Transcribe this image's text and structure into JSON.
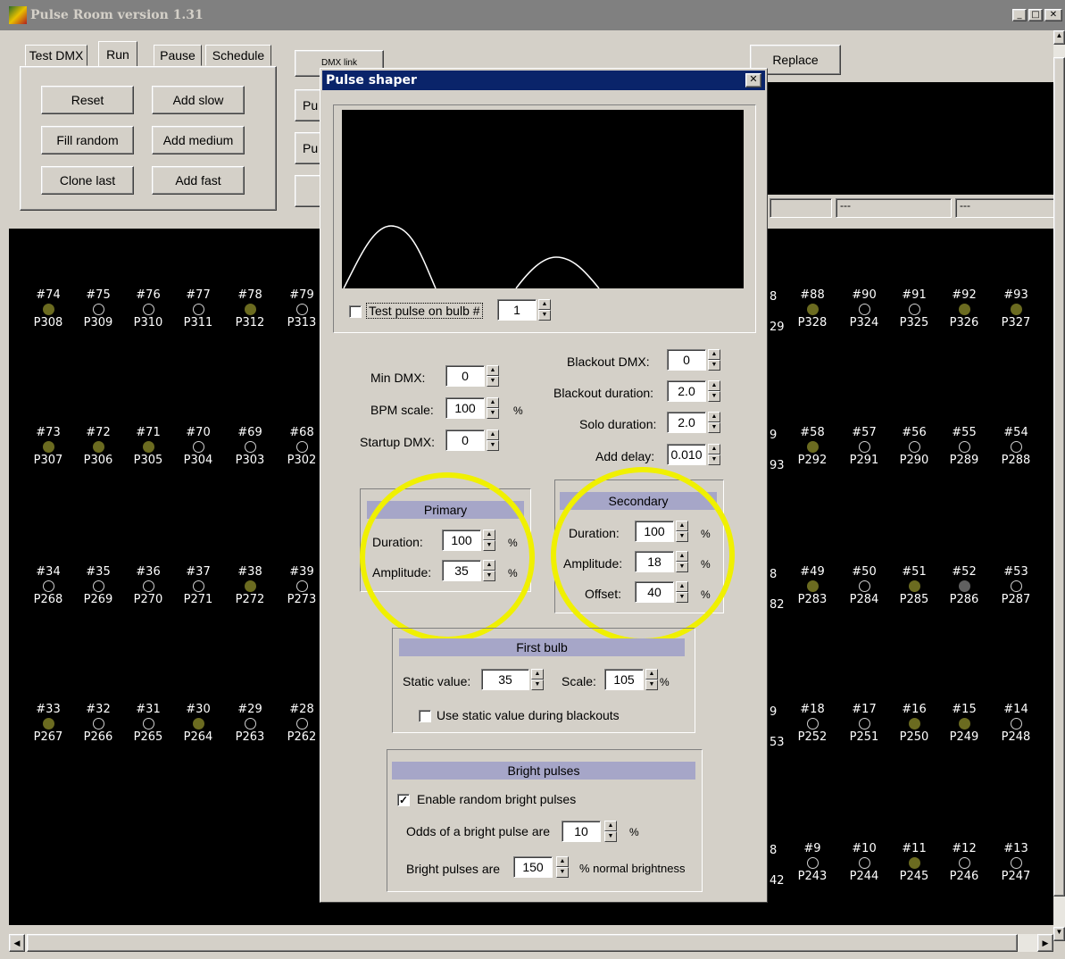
{
  "app": {
    "title": "Pulse Room version 1.31"
  },
  "tabs": [
    {
      "label": "Test DMX"
    },
    {
      "label": "Run"
    },
    {
      "label": "Pause"
    },
    {
      "label": "Schedule"
    }
  ],
  "run_buttons": {
    "reset": "Reset",
    "add_slow": "Add slow",
    "fill_random": "Fill random",
    "add_medium": "Add medium",
    "clone_last": "Clone last",
    "add_fast": "Add fast"
  },
  "hidden_buttons": {
    "dmx_link": "DMX link",
    "pu1": "Pu",
    "pu2": "Pu"
  },
  "replace_button": "Replace",
  "status_fields": [
    "---",
    "---"
  ],
  "bulbs_row1": [
    {
      "n": "#74",
      "p": "P308",
      "state": "on"
    },
    {
      "n": "#75",
      "p": "P309",
      "state": "off"
    },
    {
      "n": "#76",
      "p": "P310",
      "state": "off"
    },
    {
      "n": "#77",
      "p": "P311",
      "state": "off"
    },
    {
      "n": "#78",
      "p": "P312",
      "state": "on"
    },
    {
      "n": "#79",
      "p": "P313",
      "state": "off"
    },
    {
      "n": "#88",
      "p": "P328",
      "state": "on"
    },
    {
      "n": "#90",
      "p": "P324",
      "state": "off"
    },
    {
      "n": "#91",
      "p": "P325",
      "state": "off"
    },
    {
      "n": "#92",
      "p": "P326",
      "state": "on"
    },
    {
      "n": "#93",
      "p": "P327",
      "state": "on"
    }
  ],
  "bulbs_row2": [
    {
      "n": "#73",
      "p": "P307",
      "state": "on"
    },
    {
      "n": "#72",
      "p": "P306",
      "state": "on"
    },
    {
      "n": "#71",
      "p": "P305",
      "state": "on"
    },
    {
      "n": "#70",
      "p": "P304",
      "state": "off"
    },
    {
      "n": "#69",
      "p": "P303",
      "state": "off"
    },
    {
      "n": "#68",
      "p": "P302",
      "state": "off"
    },
    {
      "n": "#58",
      "p": "P292",
      "state": "on"
    },
    {
      "n": "#57",
      "p": "P291",
      "state": "off"
    },
    {
      "n": "#56",
      "p": "P290",
      "state": "off"
    },
    {
      "n": "#55",
      "p": "P289",
      "state": "off"
    },
    {
      "n": "#54",
      "p": "P288",
      "state": "off"
    }
  ],
  "bulbs_row3": [
    {
      "n": "#34",
      "p": "P268",
      "state": "off"
    },
    {
      "n": "#35",
      "p": "P269",
      "state": "off"
    },
    {
      "n": "#36",
      "p": "P270",
      "state": "off"
    },
    {
      "n": "#37",
      "p": "P271",
      "state": "off"
    },
    {
      "n": "#38",
      "p": "P272",
      "state": "on"
    },
    {
      "n": "#39",
      "p": "P273",
      "state": "off"
    },
    {
      "n": "#49",
      "p": "P283",
      "state": "on"
    },
    {
      "n": "#50",
      "p": "P284",
      "state": "off"
    },
    {
      "n": "#51",
      "p": "P285",
      "state": "on"
    },
    {
      "n": "#52",
      "p": "P286",
      "state": "gray"
    },
    {
      "n": "#53",
      "p": "P287",
      "state": "off"
    }
  ],
  "bulbs_row4": [
    {
      "n": "#33",
      "p": "P267",
      "state": "on"
    },
    {
      "n": "#32",
      "p": "P266",
      "state": "off"
    },
    {
      "n": "#31",
      "p": "P265",
      "state": "off"
    },
    {
      "n": "#30",
      "p": "P264",
      "state": "on"
    },
    {
      "n": "#29",
      "p": "P263",
      "state": "off"
    },
    {
      "n": "#28",
      "p": "P262",
      "state": "off"
    },
    {
      "n": "#18",
      "p": "P252",
      "state": "off"
    },
    {
      "n": "#17",
      "p": "P251",
      "state": "off"
    },
    {
      "n": "#16",
      "p": "P250",
      "state": "on"
    },
    {
      "n": "#15",
      "p": "P249",
      "state": "on"
    },
    {
      "n": "#14",
      "p": "P248",
      "state": "off"
    }
  ],
  "bulbs_row5": [
    {
      "n": "#9",
      "p": "P243",
      "state": "off"
    },
    {
      "n": "#10",
      "p": "P244",
      "state": "off"
    },
    {
      "n": "#11",
      "p": "P245",
      "state": "on"
    },
    {
      "n": "#12",
      "p": "P246",
      "state": "off"
    },
    {
      "n": "#13",
      "p": "P247",
      "state": "off"
    }
  ],
  "partial_labels": {
    "r1a": "8",
    "r1b": "29",
    "r2a": "9",
    "r2b": "93",
    "r3a": "8",
    "r3b": "82",
    "r4a": "9",
    "r4b": "53",
    "r5a": "8",
    "r5b": "42"
  },
  "dialog": {
    "title": "Pulse shaper",
    "test_pulse_label": "Test pulse on bulb #",
    "test_pulse_value": "1",
    "min_dmx_label": "Min DMX:",
    "min_dmx": "0",
    "bpm_scale_label": "BPM scale:",
    "bpm_scale": "100",
    "bpm_unit": "%",
    "startup_dmx_label": "Startup DMX:",
    "startup_dmx": "0",
    "blackout_dmx_label": "Blackout DMX:",
    "blackout_dmx": "0",
    "blackout_duration_label": "Blackout duration:",
    "blackout_duration": "2.0",
    "solo_duration_label": "Solo duration:",
    "solo_duration": "2.0",
    "add_delay_label": "Add delay:",
    "add_delay": "0.010",
    "primary": {
      "title": "Primary",
      "duration_label": "Duration:",
      "duration": "100",
      "amplitude_label": "Amplitude:",
      "amplitude": "35",
      "unit": "%"
    },
    "secondary": {
      "title": "Secondary",
      "duration_label": "Duration:",
      "duration": "100",
      "amplitude_label": "Amplitude:",
      "amplitude": "18",
      "offset_label": "Offset:",
      "offset": "40",
      "unit": "%"
    },
    "first_bulb": {
      "title": "First bulb",
      "static_label": "Static value:",
      "static_value": "35",
      "scale_label": "Scale:",
      "scale": "105",
      "unit": "%",
      "use_static_label": "Use static value during blackouts"
    },
    "bright": {
      "title": "Bright pulses",
      "enable_label": "Enable random bright pulses",
      "odds_label": "Odds of a bright pulse are",
      "odds": "10",
      "odds_unit": "%",
      "bright_label": "Bright pulses are",
      "bright_value": "150",
      "bright_suffix": "% normal brightness"
    }
  }
}
